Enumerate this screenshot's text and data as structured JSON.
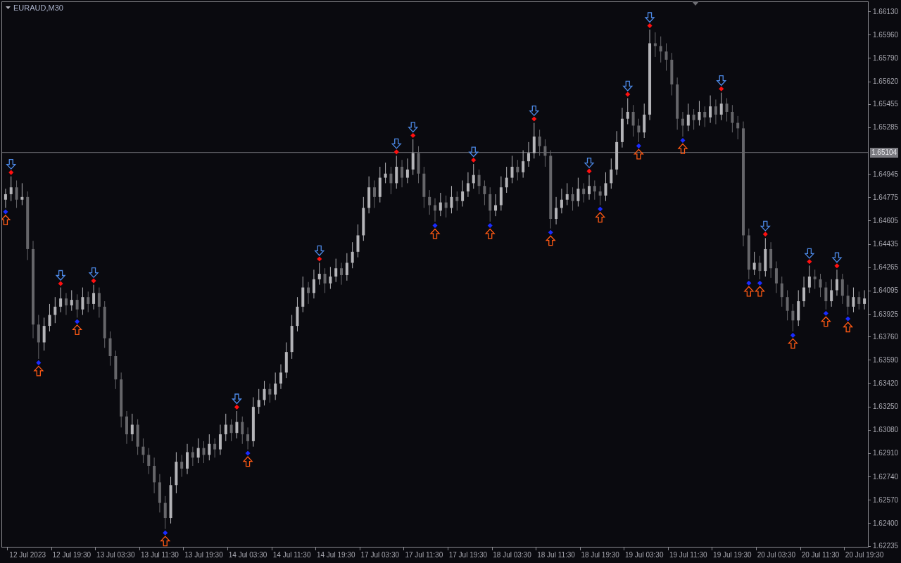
{
  "chart": {
    "title": "EURAUD,M30",
    "chart_data": {
      "type": "candlestick",
      "categories": [
        null,
        null,
        null,
        null,
        "12 Jul 2023",
        null,
        null,
        null,
        null,
        null,
        null,
        null,
        "12 Jul 19:30",
        null,
        null,
        null,
        null,
        null,
        null,
        null,
        "13 Jul 03:30",
        null,
        null,
        null,
        null,
        null,
        null,
        null,
        "13 Jul 11:30",
        null,
        null,
        null,
        null,
        null,
        null,
        null,
        "13 Jul 19:30",
        null,
        null,
        null,
        null,
        null,
        null,
        null,
        "14 Jul 03:30",
        null,
        null,
        null,
        null,
        null,
        null,
        null,
        "14 Jul 11:30",
        null,
        null,
        null,
        null,
        null,
        null,
        null,
        "14 Jul 19:30",
        null,
        null,
        null,
        null,
        null,
        null,
        null,
        "17 Jul 03:30",
        null,
        null,
        null,
        null,
        null,
        null,
        null,
        "17 Jul 11:30",
        null,
        null,
        null,
        null,
        null,
        null,
        null,
        "17 Jul 19:30",
        null,
        null,
        null,
        null,
        null,
        null,
        null,
        "18 Jul 03:30",
        null,
        null,
        null,
        null,
        null,
        null,
        null,
        "18 Jul 11:30",
        null,
        null,
        null,
        null,
        null,
        null,
        null,
        "18 Jul 19:30",
        null,
        null,
        null,
        null,
        null,
        null,
        null,
        "19 Jul 03:30",
        null,
        null,
        null,
        null,
        null,
        null,
        null,
        "19 Jul 11:30",
        null,
        null,
        null,
        null,
        null,
        null,
        null,
        "19 Jul 19:30",
        null,
        null,
        null,
        null,
        null,
        null,
        null,
        "20 Jul 03:30",
        null,
        null,
        null,
        null,
        null,
        null,
        null,
        "20 Jul 11:30",
        null,
        null,
        null,
        null,
        null,
        null,
        null,
        "20 Jul 19:30"
      ],
      "ohlc": [
        [
          1.6476,
          1.6484,
          1.647,
          1.648
        ],
        [
          1.648,
          1.6493,
          1.6475,
          1.6485
        ],
        [
          1.6485,
          1.649,
          1.647,
          1.6476
        ],
        [
          1.6476,
          1.6488,
          1.6472,
          1.6478
        ],
        [
          1.6478,
          1.6482,
          1.6432,
          1.644
        ],
        [
          1.644,
          1.6446,
          1.6375,
          1.6385
        ],
        [
          1.6385,
          1.6392,
          1.636,
          1.6372
        ],
        [
          1.6372,
          1.639,
          1.6366,
          1.6384
        ],
        [
          1.6384,
          1.64,
          1.638,
          1.6392
        ],
        [
          1.6392,
          1.6405,
          1.6386,
          1.6398
        ],
        [
          1.6398,
          1.6412,
          1.6394,
          1.6404
        ],
        [
          1.6404,
          1.6408,
          1.6392,
          1.6399
        ],
        [
          1.6399,
          1.641,
          1.6395,
          1.6403
        ],
        [
          1.6403,
          1.6407,
          1.639,
          1.6396
        ],
        [
          1.6396,
          1.6412,
          1.6392,
          1.6405
        ],
        [
          1.6405,
          1.6409,
          1.6394,
          1.64
        ],
        [
          1.64,
          1.6414,
          1.6396,
          1.6408
        ],
        [
          1.6408,
          1.6412,
          1.639,
          1.6398
        ],
        [
          1.6398,
          1.6402,
          1.6368,
          1.6375
        ],
        [
          1.6375,
          1.638,
          1.6355,
          1.6362
        ],
        [
          1.6362,
          1.6366,
          1.6338,
          1.6345
        ],
        [
          1.6345,
          1.635,
          1.631,
          1.6318
        ],
        [
          1.6318,
          1.6322,
          1.6298,
          1.6305
        ],
        [
          1.6305,
          1.632,
          1.63,
          1.6312
        ],
        [
          1.6312,
          1.6316,
          1.629,
          1.6296
        ],
        [
          1.6296,
          1.6302,
          1.6284,
          1.629
        ],
        [
          1.629,
          1.6295,
          1.6276,
          1.6282
        ],
        [
          1.6282,
          1.6288,
          1.6262,
          1.627
        ],
        [
          1.627,
          1.6276,
          1.6248,
          1.6255
        ],
        [
          1.6255,
          1.626,
          1.6236,
          1.6244
        ],
        [
          1.6244,
          1.6274,
          1.624,
          1.6268
        ],
        [
          1.6268,
          1.6292,
          1.6262,
          1.6285
        ],
        [
          1.6285,
          1.629,
          1.6274,
          1.628
        ],
        [
          1.628,
          1.6298,
          1.6276,
          1.6292
        ],
        [
          1.6292,
          1.6296,
          1.6282,
          1.6288
        ],
        [
          1.6288,
          1.6302,
          1.6284,
          1.6295
        ],
        [
          1.6295,
          1.63,
          1.6284,
          1.629
        ],
        [
          1.629,
          1.6305,
          1.6286,
          1.6298
        ],
        [
          1.6298,
          1.6302,
          1.6288,
          1.6294
        ],
        [
          1.6294,
          1.6312,
          1.629,
          1.6305
        ],
        [
          1.6305,
          1.632,
          1.63,
          1.6312
        ],
        [
          1.6312,
          1.6316,
          1.63,
          1.6306
        ],
        [
          1.6306,
          1.6322,
          1.6302,
          1.6314
        ],
        [
          1.6314,
          1.6318,
          1.6298,
          1.6305
        ],
        [
          1.6305,
          1.631,
          1.6294,
          1.63
        ],
        [
          1.63,
          1.6332,
          1.6296,
          1.6325
        ],
        [
          1.6325,
          1.6338,
          1.632,
          1.633
        ],
        [
          1.633,
          1.6344,
          1.6326,
          1.6338
        ],
        [
          1.6338,
          1.6342,
          1.6328,
          1.6334
        ],
        [
          1.6334,
          1.635,
          1.633,
          1.6342
        ],
        [
          1.6342,
          1.6356,
          1.6338,
          1.635
        ],
        [
          1.635,
          1.6372,
          1.6346,
          1.6365
        ],
        [
          1.6365,
          1.6392,
          1.636,
          1.6384
        ],
        [
          1.6384,
          1.6405,
          1.638,
          1.6398
        ],
        [
          1.6398,
          1.642,
          1.6394,
          1.6412
        ],
        [
          1.6412,
          1.6416,
          1.64,
          1.6408
        ],
        [
          1.6408,
          1.6425,
          1.6404,
          1.6418
        ],
        [
          1.6418,
          1.643,
          1.6414,
          1.6422
        ],
        [
          1.6422,
          1.6426,
          1.6408,
          1.6415
        ],
        [
          1.6415,
          1.6427,
          1.6411,
          1.642
        ],
        [
          1.642,
          1.6433,
          1.6416,
          1.6426
        ],
        [
          1.6426,
          1.643,
          1.6414,
          1.6421
        ],
        [
          1.6421,
          1.6437,
          1.6417,
          1.643
        ],
        [
          1.643,
          1.6445,
          1.6426,
          1.6438
        ],
        [
          1.6438,
          1.6458,
          1.6434,
          1.645
        ],
        [
          1.645,
          1.6478,
          1.6446,
          1.647
        ],
        [
          1.647,
          1.6493,
          1.6466,
          1.6485
        ],
        [
          1.6485,
          1.649,
          1.647,
          1.6478
        ],
        [
          1.6478,
          1.65,
          1.6474,
          1.6492
        ],
        [
          1.6492,
          1.6503,
          1.6488,
          1.6495
        ],
        [
          1.6495,
          1.65,
          1.648,
          1.6488
        ],
        [
          1.6488,
          1.6508,
          1.6484,
          1.65
        ],
        [
          1.65,
          1.6505,
          1.6485,
          1.6492
        ],
        [
          1.6492,
          1.6506,
          1.6488,
          1.6498
        ],
        [
          1.6498,
          1.652,
          1.6494,
          1.651
        ],
        [
          1.651,
          1.6515,
          1.6488,
          1.6495
        ],
        [
          1.6495,
          1.65,
          1.647,
          1.6478
        ],
        [
          1.6478,
          1.6483,
          1.6465,
          1.6472
        ],
        [
          1.6472,
          1.6477,
          1.646,
          1.6468
        ],
        [
          1.6468,
          1.6481,
          1.6464,
          1.6474
        ],
        [
          1.6474,
          1.6479,
          1.6463,
          1.647
        ],
        [
          1.647,
          1.6486,
          1.6466,
          1.6478
        ],
        [
          1.6478,
          1.6482,
          1.6468,
          1.6475
        ],
        [
          1.6475,
          1.649,
          1.6471,
          1.6482
        ],
        [
          1.6482,
          1.6496,
          1.6478,
          1.6488
        ],
        [
          1.6488,
          1.6502,
          1.6484,
          1.6494
        ],
        [
          1.6494,
          1.6498,
          1.648,
          1.6486
        ],
        [
          1.6486,
          1.649,
          1.6472,
          1.648
        ],
        [
          1.648,
          1.6485,
          1.646,
          1.6468
        ],
        [
          1.6468,
          1.648,
          1.6464,
          1.6472
        ],
        [
          1.6472,
          1.6493,
          1.6468,
          1.6485
        ],
        [
          1.6485,
          1.65,
          1.6481,
          1.6492
        ],
        [
          1.6492,
          1.6508,
          1.6488,
          1.65
        ],
        [
          1.65,
          1.6505,
          1.649,
          1.6496
        ],
        [
          1.6496,
          1.6512,
          1.6492,
          1.6504
        ],
        [
          1.6504,
          1.6518,
          1.65,
          1.651
        ],
        [
          1.651,
          1.6532,
          1.6506,
          1.6522
        ],
        [
          1.6522,
          1.6527,
          1.6508,
          1.6515
        ],
        [
          1.6515,
          1.652,
          1.65,
          1.6508
        ],
        [
          1.6508,
          1.6512,
          1.6455,
          1.6462
        ],
        [
          1.6462,
          1.6478,
          1.6458,
          1.647
        ],
        [
          1.647,
          1.6484,
          1.6466,
          1.6476
        ],
        [
          1.6476,
          1.6488,
          1.6472,
          1.648
        ],
        [
          1.648,
          1.6485,
          1.6468,
          1.6475
        ],
        [
          1.6475,
          1.6492,
          1.6471,
          1.6484
        ],
        [
          1.6484,
          1.6488,
          1.6474,
          1.648
        ],
        [
          1.648,
          1.6494,
          1.6476,
          1.6486
        ],
        [
          1.6486,
          1.649,
          1.6476,
          1.6482
        ],
        [
          1.6482,
          1.6486,
          1.6472,
          1.6479
        ],
        [
          1.6479,
          1.6496,
          1.6475,
          1.6488
        ],
        [
          1.6488,
          1.6506,
          1.6484,
          1.6498
        ],
        [
          1.6498,
          1.6526,
          1.6494,
          1.6518
        ],
        [
          1.6518,
          1.6543,
          1.6514,
          1.6535
        ],
        [
          1.6535,
          1.655,
          1.6531,
          1.654
        ],
        [
          1.654,
          1.6545,
          1.6522,
          1.653
        ],
        [
          1.653,
          1.6535,
          1.6518,
          1.6525
        ],
        [
          1.6525,
          1.6546,
          1.6521,
          1.6538
        ],
        [
          1.6538,
          1.66,
          1.6534,
          1.659
        ],
        [
          1.659,
          1.6598,
          1.658,
          1.6588
        ],
        [
          1.6588,
          1.6595,
          1.6576,
          1.6584
        ],
        [
          1.6584,
          1.659,
          1.657,
          1.6578
        ],
        [
          1.6578,
          1.6583,
          1.6552,
          1.656
        ],
        [
          1.656,
          1.6565,
          1.6527,
          1.6535
        ],
        [
          1.6535,
          1.654,
          1.6522,
          1.653
        ],
        [
          1.653,
          1.6546,
          1.6526,
          1.6538
        ],
        [
          1.6538,
          1.6542,
          1.6527,
          1.6534
        ],
        [
          1.6534,
          1.6548,
          1.653,
          1.654
        ],
        [
          1.654,
          1.6544,
          1.6529,
          1.6536
        ],
        [
          1.6536,
          1.6552,
          1.6532,
          1.6544
        ],
        [
          1.6544,
          1.6549,
          1.6531,
          1.6538
        ],
        [
          1.6538,
          1.6554,
          1.6534,
          1.6546
        ],
        [
          1.6546,
          1.655,
          1.6533,
          1.654
        ],
        [
          1.654,
          1.6545,
          1.6525,
          1.6532
        ],
        [
          1.6532,
          1.6537,
          1.652,
          1.6528
        ],
        [
          1.6528,
          1.6533,
          1.6442,
          1.645
        ],
        [
          1.645,
          1.6455,
          1.6418,
          1.6425
        ],
        [
          1.6425,
          1.6438,
          1.6421,
          1.643
        ],
        [
          1.643,
          1.6435,
          1.6418,
          1.6424
        ],
        [
          1.6424,
          1.6448,
          1.642,
          1.644
        ],
        [
          1.644,
          1.6445,
          1.6419,
          1.6426
        ],
        [
          1.6426,
          1.6431,
          1.6408,
          1.6415
        ],
        [
          1.6415,
          1.642,
          1.6398,
          1.6405
        ],
        [
          1.6405,
          1.641,
          1.6388,
          1.6395
        ],
        [
          1.6395,
          1.64,
          1.638,
          1.6388
        ],
        [
          1.6388,
          1.641,
          1.6384,
          1.6402
        ],
        [
          1.6402,
          1.642,
          1.6398,
          1.6412
        ],
        [
          1.6412,
          1.6428,
          1.6408,
          1.642
        ],
        [
          1.642,
          1.6425,
          1.6411,
          1.6418
        ],
        [
          1.6418,
          1.6422,
          1.6405,
          1.6412
        ],
        [
          1.6412,
          1.6416,
          1.6396,
          1.6402
        ],
        [
          1.6402,
          1.6418,
          1.6398,
          1.641
        ],
        [
          1.641,
          1.6425,
          1.6406,
          1.6418
        ],
        [
          1.6418,
          1.6422,
          1.64,
          1.6406
        ],
        [
          1.6406,
          1.6414,
          1.6392,
          1.6398
        ],
        [
          1.6398,
          1.6412,
          1.6394,
          1.6405
        ],
        [
          1.6405,
          1.6409,
          1.6396,
          1.64
        ],
        [
          1.64,
          1.641,
          1.6396,
          1.6404
        ]
      ],
      "ylim": [
        1.6223,
        1.662
      ],
      "ref_lines": [
        {
          "axis": "y",
          "value": 1.65104,
          "label": "1.65104"
        }
      ],
      "yticks": [
        {
          "value": 1.6613,
          "label": "1.66130"
        },
        {
          "value": 1.6596,
          "label": "1.65960"
        },
        {
          "value": 1.6579,
          "label": "1.65790"
        },
        {
          "value": 1.6562,
          "label": "1.65620"
        },
        {
          "value": 1.65455,
          "label": "1.65455"
        },
        {
          "value": 1.65285,
          "label": "1.65285"
        },
        {
          "value": 1.64945,
          "label": "1.64945"
        },
        {
          "value": 1.64775,
          "label": "1.64775"
        },
        {
          "value": 1.64605,
          "label": "1.64605"
        },
        {
          "value": 1.64435,
          "label": "1.64435"
        },
        {
          "value": 1.64265,
          "label": "1.64265"
        },
        {
          "value": 1.64095,
          "label": "1.64095"
        },
        {
          "value": 1.63925,
          "label": "1.63925"
        },
        {
          "value": 1.6376,
          "label": "1.63760"
        },
        {
          "value": 1.6359,
          "label": "1.63590"
        },
        {
          "value": 1.6342,
          "label": "1.63420"
        },
        {
          "value": 1.6325,
          "label": "1.63250"
        },
        {
          "value": 1.6308,
          "label": "1.63080"
        },
        {
          "value": 1.6291,
          "label": "1.62910"
        },
        {
          "value": 1.6274,
          "label": "1.62740"
        },
        {
          "value": 1.6257,
          "label": "1.62570"
        },
        {
          "value": 1.624,
          "label": "1.62400"
        },
        {
          "value": 1.62235,
          "label": "1.62235"
        }
      ]
    }
  }
}
